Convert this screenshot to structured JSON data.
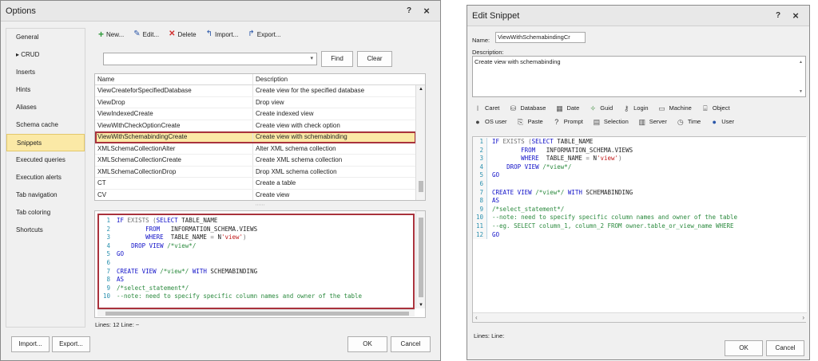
{
  "options_window": {
    "title": "Options",
    "help_label": "?",
    "close_label": "×",
    "sidebar": {
      "items": [
        {
          "label": "General",
          "prefix": ""
        },
        {
          "label": "CRUD",
          "prefix": "▸ "
        },
        {
          "label": "Inserts",
          "prefix": ""
        },
        {
          "label": "Hints",
          "prefix": ""
        },
        {
          "label": "Aliases",
          "prefix": ""
        },
        {
          "label": "Schema cache",
          "prefix": ""
        },
        {
          "label": "Snippets",
          "prefix": "",
          "selected": true
        },
        {
          "label": "Executed queries",
          "prefix": ""
        },
        {
          "label": "Execution alerts",
          "prefix": ""
        },
        {
          "label": "Tab navigation",
          "prefix": ""
        },
        {
          "label": "Tab coloring",
          "prefix": ""
        },
        {
          "label": "Shortcuts",
          "prefix": ""
        }
      ]
    },
    "toolbar": {
      "new_label": "New...",
      "edit_label": "Edit...",
      "delete_label": "Delete",
      "import_label": "Import...",
      "export_label": "Export..."
    },
    "search": {
      "value": "",
      "find_label": "Find",
      "clear_label": "Clear"
    },
    "grid": {
      "columns": [
        "Name",
        "Description"
      ],
      "rows": [
        [
          "ViewCreateforSpecifiedDatabase",
          "Create view for the specified database"
        ],
        [
          "ViewDrop",
          "Drop view"
        ],
        [
          "ViewIndexedCreate",
          "Create indexed view"
        ],
        [
          "ViewWithCheckOptionCreate",
          "Create view with check option"
        ],
        [
          "ViewWithSchemabindingCreate",
          "Create view with schemabinding"
        ],
        [
          "XMLSchemaCollectionAlter",
          "Alter XML schema collection"
        ],
        [
          "XMLSchemaCollectionCreate",
          "Create XML schema collection"
        ],
        [
          "XMLSchemaCollectionDrop",
          "Drop XML schema collection"
        ],
        [
          "CT",
          "Create a table"
        ],
        [
          "CV",
          "Create view"
        ]
      ],
      "selected_index": 4
    },
    "status": "Lines: 12   Line: ~",
    "footer": {
      "import_label": "Import...",
      "export_label": "Export...",
      "ok_label": "OK",
      "cancel_label": "Cancel"
    }
  },
  "edit_window": {
    "title": "Edit Snippet",
    "help_label": "?",
    "close_label": "×",
    "name_label": "Name:",
    "name_value": "ViewWithSchemabindingCr",
    "description_label": "Description:",
    "description_value": "Create view with schemabinding",
    "variables": [
      {
        "label": "Caret",
        "icon": "caret-icon"
      },
      {
        "label": "Database",
        "icon": "database-icon"
      },
      {
        "label": "Date",
        "icon": "calendar-icon"
      },
      {
        "label": "Guid",
        "icon": "guid-icon"
      },
      {
        "label": "Login",
        "icon": "login-icon"
      },
      {
        "label": "Machine",
        "icon": "machine-icon"
      },
      {
        "label": "Object",
        "icon": "object-icon"
      },
      {
        "label": "OS user",
        "icon": "os-user-icon"
      },
      {
        "label": "Paste",
        "icon": "paste-icon"
      },
      {
        "label": "Prompt",
        "icon": "prompt-icon"
      },
      {
        "label": "Selection",
        "icon": "selection-icon"
      },
      {
        "label": "Server",
        "icon": "server-icon"
      },
      {
        "label": "Time",
        "icon": "clock-icon"
      },
      {
        "label": "User",
        "icon": "user-icon"
      }
    ],
    "status": "Lines:    Line:",
    "ok_label": "OK",
    "cancel_label": "Cancel"
  },
  "code_preview": {
    "lines": [
      {
        "n": "1",
        "segs": [
          [
            "kw",
            "IF "
          ],
          [
            "op",
            "EXISTS "
          ],
          [
            "op",
            "("
          ],
          [
            "kw",
            "SELECT "
          ],
          [
            "pl",
            "TABLE_NAME"
          ]
        ]
      },
      {
        "n": "2",
        "segs": [
          [
            "pl",
            "        "
          ],
          [
            "kw",
            "FROM   "
          ],
          [
            "pl",
            "INFORMATION_SCHEMA.VIEWS"
          ]
        ]
      },
      {
        "n": "3",
        "segs": [
          [
            "pl",
            "        "
          ],
          [
            "kw",
            "WHERE  "
          ],
          [
            "pl",
            "TABLE_NAME "
          ],
          [
            "op",
            "= "
          ],
          [
            "pl",
            "N"
          ],
          [
            "str",
            "'view'"
          ],
          [
            "op",
            ")"
          ]
        ]
      },
      {
        "n": "4",
        "segs": [
          [
            "pl",
            "    "
          ],
          [
            "kw",
            "DROP VIEW "
          ],
          [
            "cm",
            "/*view*/"
          ]
        ]
      },
      {
        "n": "5",
        "segs": [
          [
            "kw",
            "GO"
          ]
        ]
      },
      {
        "n": "6",
        "segs": []
      },
      {
        "n": "7",
        "segs": [
          [
            "kw",
            "CREATE VIEW "
          ],
          [
            "cm",
            "/*view*/ "
          ],
          [
            "kw",
            "WITH "
          ],
          [
            "pl",
            "SCHEMABINDING"
          ]
        ]
      },
      {
        "n": "8",
        "segs": [
          [
            "kw",
            "AS"
          ]
        ]
      },
      {
        "n": "9",
        "segs": [
          [
            "cm",
            "/*select_statement*/"
          ]
        ]
      },
      {
        "n": "10",
        "segs": [
          [
            "cm",
            "--note: need to specify specific column names and owner of the table"
          ]
        ]
      },
      {
        "n": "11",
        "segs": [
          [
            "cm",
            "--eg. SELECT column_1, column_2 FROM owner.table_or_view_name WHERE"
          ]
        ]
      },
      {
        "n": "12",
        "segs": [
          [
            "kw",
            "GO"
          ]
        ]
      }
    ]
  }
}
